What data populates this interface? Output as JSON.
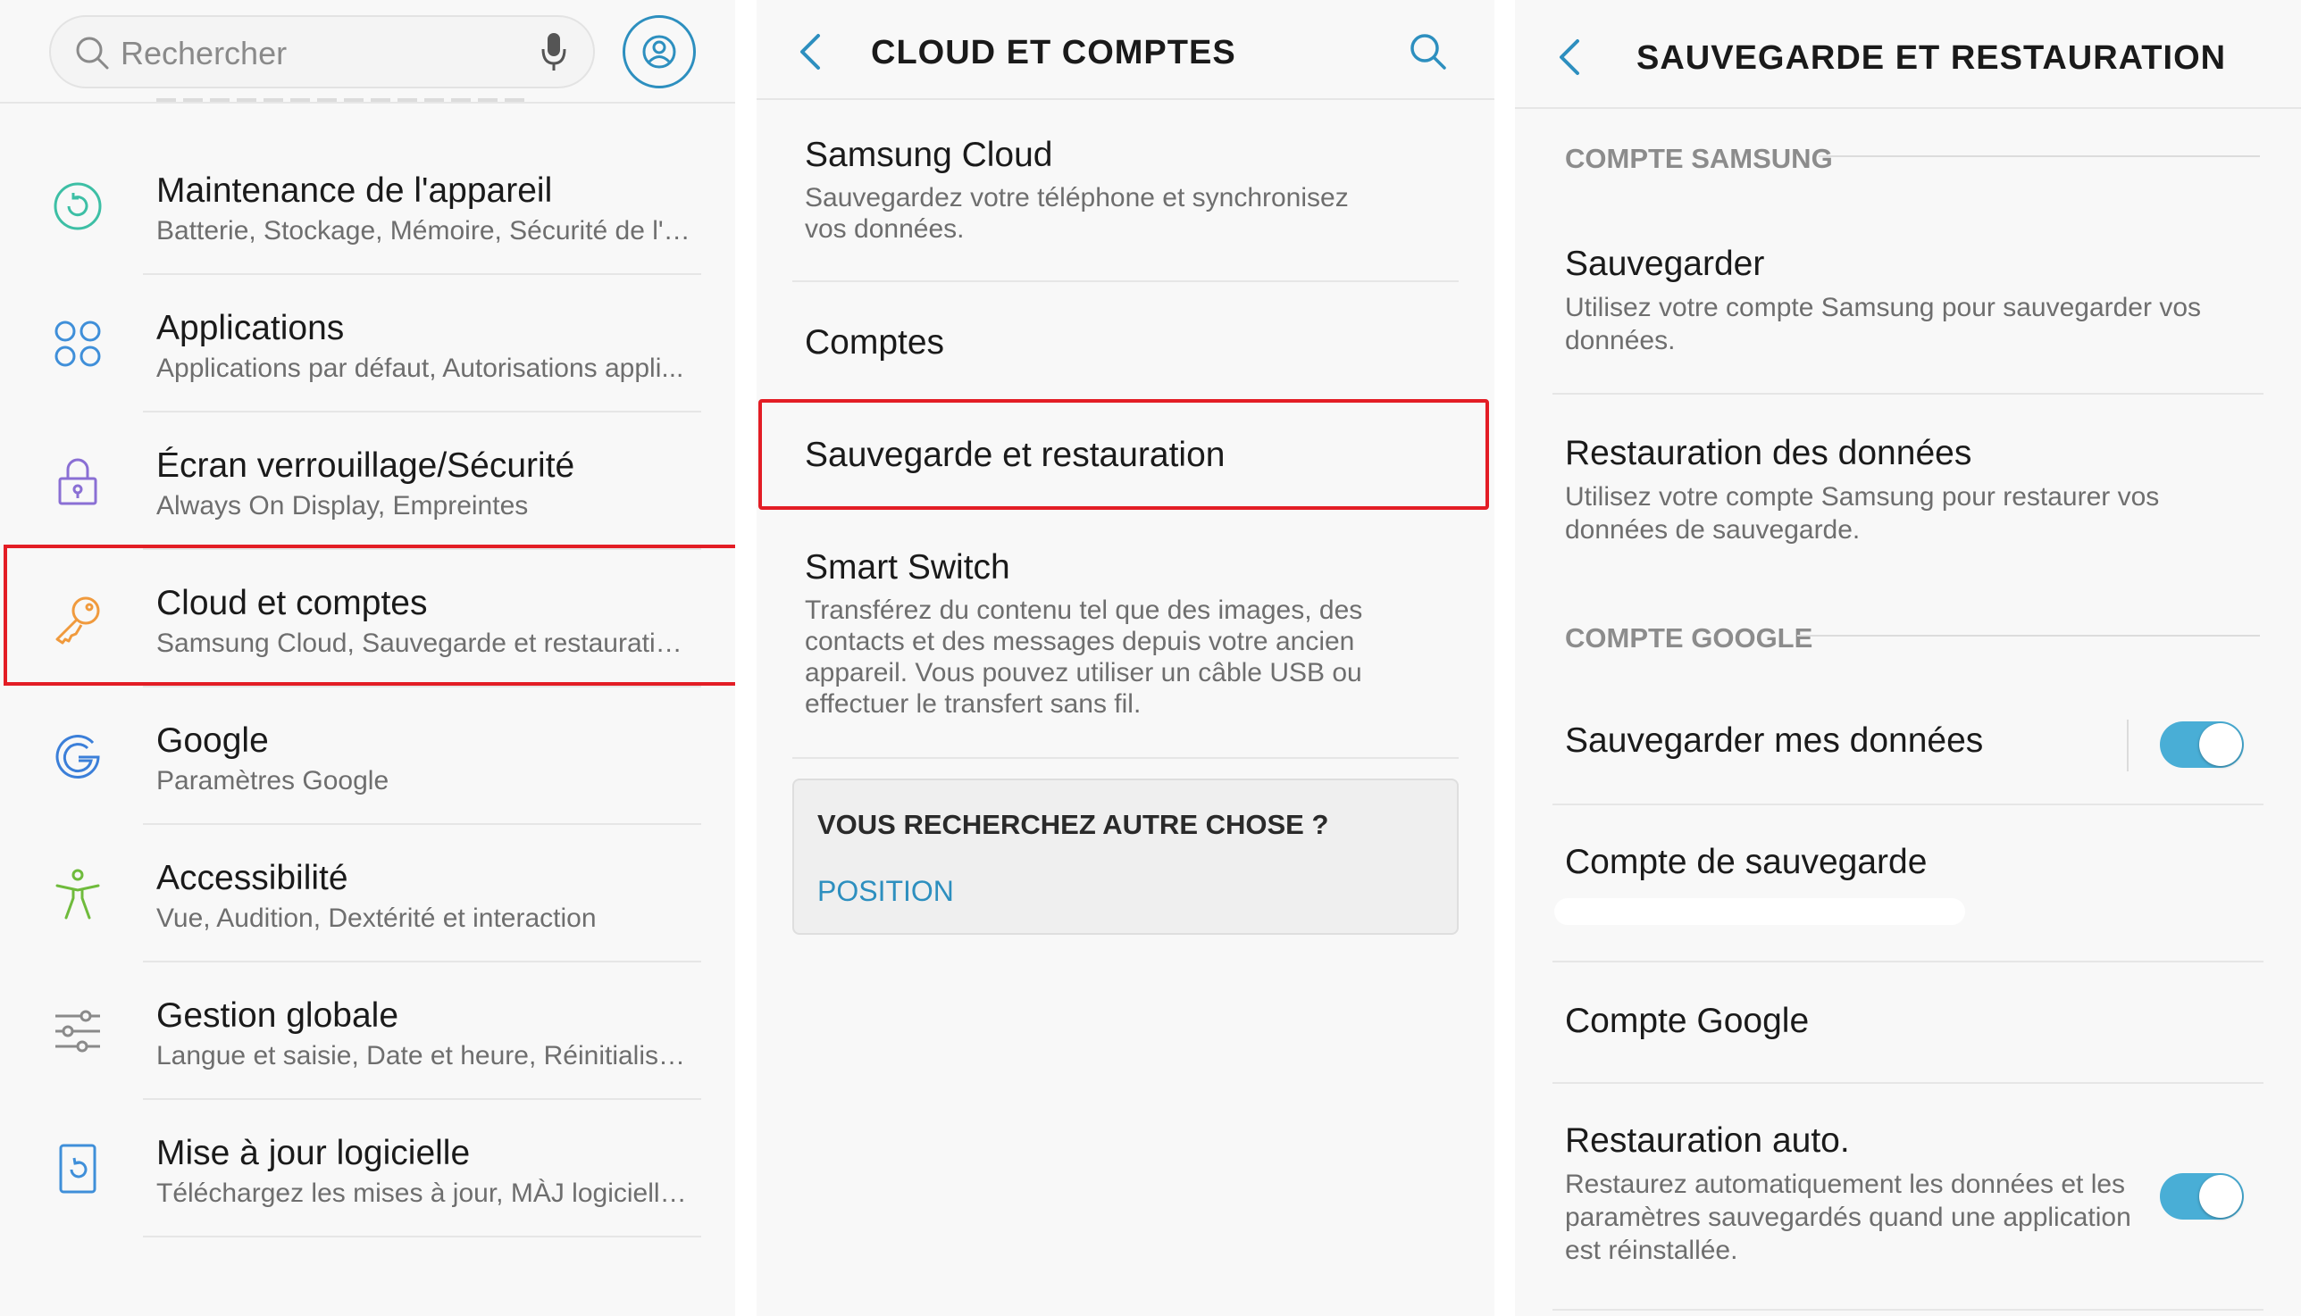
{
  "panel1": {
    "search_placeholder": "Rechercher",
    "icon_search": "search-icon",
    "icon_mic": "mic-icon",
    "icon_account": "account-icon",
    "items": [
      {
        "title": "Maintenance de l'appareil",
        "subtitle": "Batterie, Stockage, Mémoire, Sécurité de l'a...",
        "icon": "maintenance-icon",
        "color": "#3dbfa5"
      },
      {
        "title": "Applications",
        "subtitle": "Applications par défaut, Autorisations appli...",
        "icon": "apps-icon",
        "color": "#3f8fd9"
      },
      {
        "title": "Écran verrouillage/Sécurité",
        "subtitle": "Always On Display, Empreintes",
        "icon": "lock-icon",
        "color": "#8a6fd4"
      },
      {
        "title": "Cloud et comptes",
        "subtitle": "Samsung Cloud, Sauvegarde et restauratio...",
        "icon": "key-icon",
        "color": "#f09a3d"
      },
      {
        "title": "Google",
        "subtitle": "Paramètres Google",
        "icon": "google-icon",
        "color": "#3b7fd9"
      },
      {
        "title": "Accessibilité",
        "subtitle": "Vue, Audition, Dextérité et interaction",
        "icon": "accessibility-icon",
        "color": "#6fbb3c"
      },
      {
        "title": "Gestion globale",
        "subtitle": "Langue et saisie, Date et heure, Réinitialisat...",
        "icon": "sliders-icon",
        "color": "#8a8a8a"
      },
      {
        "title": "Mise à jour logicielle",
        "subtitle": "Téléchargez les mises à jour, MÀJ logicielle...",
        "icon": "update-icon",
        "color": "#3f8fd9"
      }
    ]
  },
  "panel2": {
    "header_title": "CLOUD ET COMPTES",
    "icon_back": "back-chevron-icon",
    "icon_search": "search-icon",
    "items": [
      {
        "title": "Samsung Cloud",
        "subtitle": "Sauvegardez votre téléphone et synchronisez vos données."
      },
      {
        "title": "Comptes",
        "subtitle": ""
      },
      {
        "title": "Sauvegarde et restauration",
        "subtitle": ""
      },
      {
        "title": "Smart Switch",
        "subtitle": "Transférez du contenu tel que des images, des contacts et des messages depuis votre ancien appareil. Vous pouvez utiliser un câble USB ou effectuer le transfert sans fil."
      }
    ],
    "card": {
      "title": "VOUS RECHERCHEZ AUTRE CHOSE ?",
      "link": "POSITION"
    }
  },
  "panel3": {
    "header_title": "SAUVEGARDE ET RESTAURATION",
    "icon_back": "back-chevron-icon",
    "section_samsung": "COMPTE SAMSUNG",
    "section_google": "COMPTE GOOGLE",
    "items": [
      {
        "title": "Sauvegarder",
        "subtitle": "Utilisez votre compte Samsung pour sauvegarder vos données."
      },
      {
        "title": "Restauration des données",
        "subtitle": "Utilisez votre compte Samsung pour restaurer vos données de sauvegarde."
      },
      {
        "title": "Sauvegarder mes données",
        "subtitle": "",
        "toggle": true
      },
      {
        "title": "Compte de sauvegarde",
        "subtitle": ""
      },
      {
        "title": "Compte Google",
        "subtitle": ""
      },
      {
        "title": "Restauration auto.",
        "subtitle": "Restaurez automatiquement les données et les paramètres sauvegardés quand une application est réinstallée.",
        "toggle": true
      }
    ],
    "accent": "#49aed6"
  }
}
